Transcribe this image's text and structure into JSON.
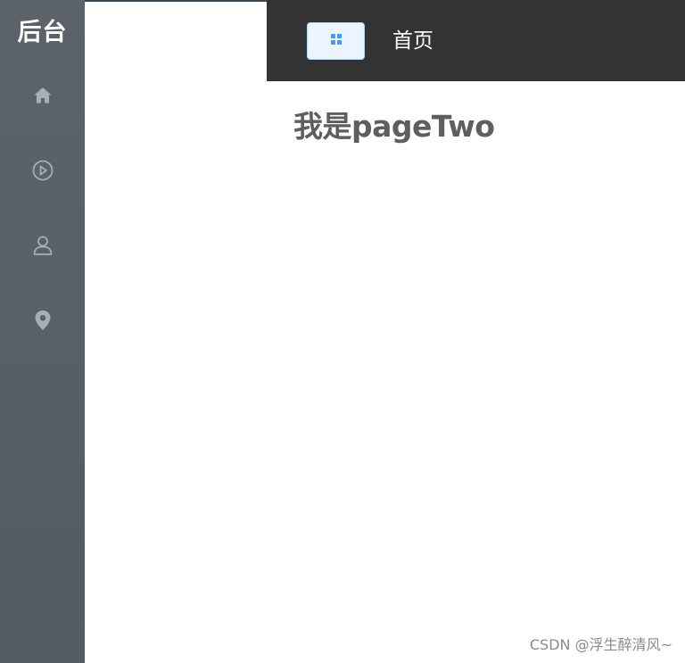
{
  "sidebar": {
    "brand": "后台",
    "items": [
      {
        "icon": "home-icon"
      },
      {
        "icon": "play-circle-icon"
      },
      {
        "icon": "user-icon"
      },
      {
        "icon": "location-pin-icon"
      }
    ],
    "icon_color": "#a9aeb4",
    "background": "#58606a"
  },
  "header": {
    "menu_icon": "grid-menu-icon",
    "title": "首页",
    "background": "#333333",
    "accent": "#409eff"
  },
  "main": {
    "heading": "我是pageTwo"
  },
  "watermark": "CSDN @浮生醉清风~"
}
